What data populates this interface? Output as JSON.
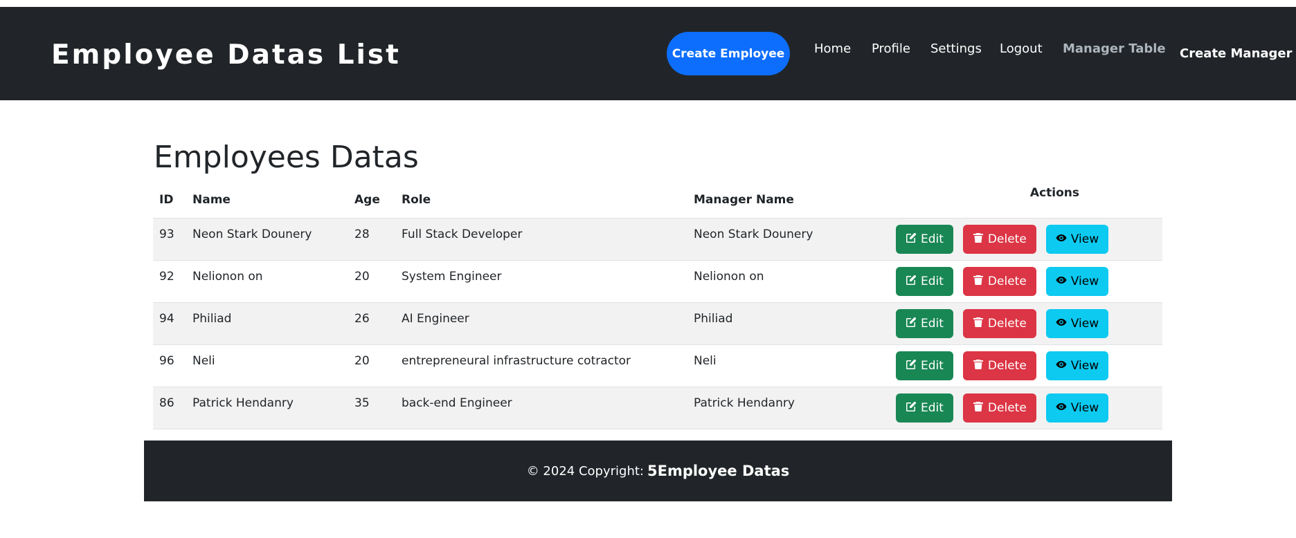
{
  "navbar": {
    "brand": "Employee Datas List",
    "create_employee": "Create Employee",
    "links": [
      "Home",
      "Profile",
      "Settings",
      "Logout"
    ],
    "manager_table": "Manager Table",
    "create_manager": "Create Manager"
  },
  "main": {
    "title": "Employees Datas",
    "columns": [
      "ID",
      "Name",
      "Age",
      "Role",
      "Manager Name",
      "Actions"
    ],
    "rows": [
      {
        "id": "93",
        "name": "Neon Stark Dounery",
        "age": "28",
        "role": "Full Stack Developer",
        "manager": "Neon Stark Dounery"
      },
      {
        "id": "92",
        "name": "Nelionon on",
        "age": "20",
        "role": "System Engineer",
        "manager": "Nelionon on"
      },
      {
        "id": "94",
        "name": "Philiad",
        "age": "26",
        "role": "AI Engineer",
        "manager": "Philiad"
      },
      {
        "id": "96",
        "name": "Neli",
        "age": "20",
        "role": "entrepreneural infrastructure cotractor",
        "manager": "Neli"
      },
      {
        "id": "86",
        "name": "Patrick Hendanry",
        "age": "35",
        "role": "back-end Engineer",
        "manager": "Patrick Hendanry"
      }
    ],
    "actions": {
      "edit": "Edit",
      "delete": "Delete",
      "view": "View"
    }
  },
  "footer": {
    "copyright": "© 2024 Copyright:",
    "brand": "5Employee Datas"
  },
  "colors": {
    "navbar_bg": "#212529",
    "primary": "#0d6efd",
    "success": "#198754",
    "danger": "#dc3545",
    "info": "#0dcaf0"
  },
  "icons": {
    "edit": "pencil-square-icon",
    "delete": "trash-icon",
    "view": "eye-icon"
  }
}
